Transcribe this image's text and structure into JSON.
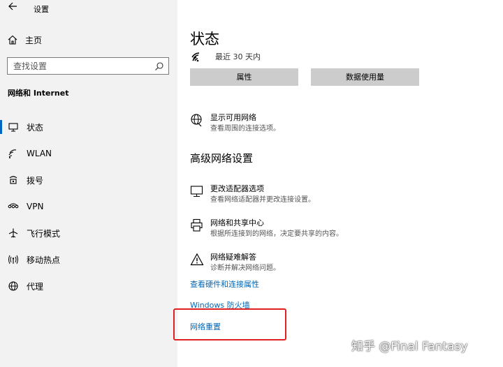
{
  "window": {
    "title": "设置",
    "back_icon": "back-arrow-icon"
  },
  "sidebar": {
    "home_label": "主页",
    "search_placeholder": "查找设置",
    "section_title": "网络和 Internet",
    "items": [
      {
        "label": "状态",
        "icon": "status-icon",
        "active": true
      },
      {
        "label": "WLAN",
        "icon": "wifi-icon",
        "active": false
      },
      {
        "label": "拨号",
        "icon": "dialup-icon",
        "active": false
      },
      {
        "label": "VPN",
        "icon": "vpn-icon",
        "active": false
      },
      {
        "label": "飞行模式",
        "icon": "airplane-icon",
        "active": false
      },
      {
        "label": "移动热点",
        "icon": "hotspot-icon",
        "active": false
      },
      {
        "label": "代理",
        "icon": "proxy-icon",
        "active": false
      }
    ]
  },
  "main": {
    "title": "状态",
    "network_status": "最近 30 天内",
    "buttons": {
      "properties": "属性",
      "data_usage": "数据使用量"
    },
    "show_networks": {
      "title": "显示可用网络",
      "desc": "查看周围的连接选项。"
    },
    "advanced_title": "高级网络设置",
    "options": [
      {
        "title": "更改适配器选项",
        "desc": "查看网络适配器并更改连接设置。"
      },
      {
        "title": "网络和共享中心",
        "desc": "根据所连接到的网络，决定要共享的内容。"
      },
      {
        "title": "网络疑难解答",
        "desc": "诊断并解决网络问题。"
      }
    ],
    "links": {
      "hardware": "查看硬件和连接属性",
      "firewall": "Windows 防火墙",
      "reset": "网络重置"
    }
  },
  "watermark": "知乎 @Final Fantasy",
  "colors": {
    "accent": "#0067c0",
    "link": "#0067b8",
    "highlight": "#e02020",
    "sidebar_bg": "#f2f2f2",
    "button_bg": "#cccccc"
  }
}
